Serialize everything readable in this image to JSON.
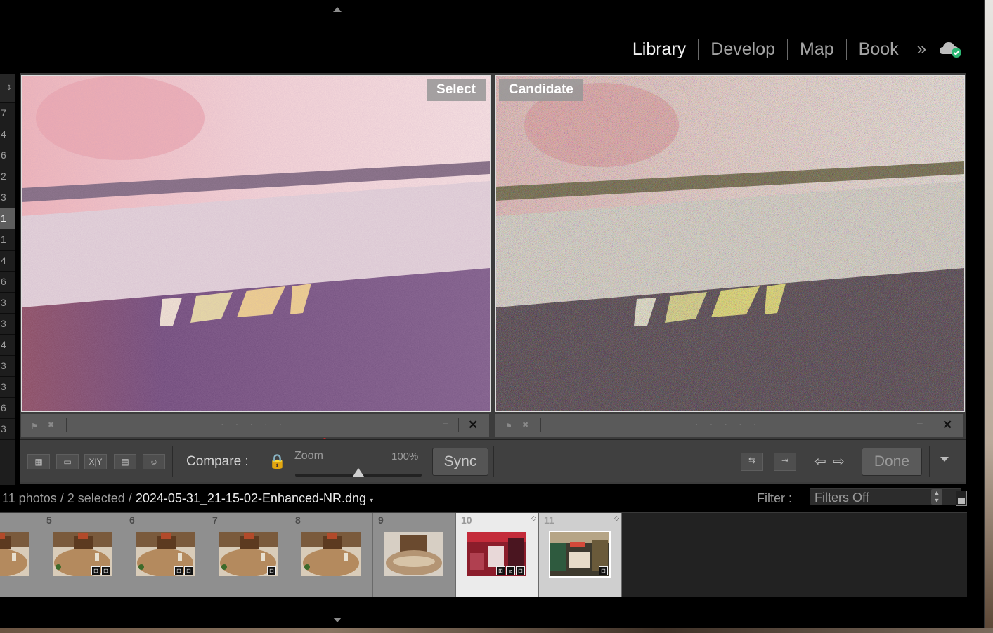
{
  "modules": [
    "Library",
    "Develop",
    "Map",
    "Book"
  ],
  "module_more": "»",
  "left_strip": {
    "top_glyph": "⇕",
    "counts": [
      "7",
      "4",
      "6",
      "2",
      "3",
      "1",
      "1",
      "4",
      "6",
      "3",
      "3",
      "4",
      "3",
      "3",
      "6",
      "3"
    ],
    "selected_index": 5
  },
  "compare": {
    "select_label": "Select",
    "candidate_label": "Candidate",
    "close_glyph": "✕"
  },
  "toolbar": {
    "compare_label": "Compare :",
    "zoom_label": "Zoom",
    "zoom_value": "100%",
    "zoom_level": 0.5,
    "sync_label": "Sync",
    "done_label": "Done",
    "icons": [
      "grid-view-icon",
      "loupe-view-icon",
      "compare-view-icon",
      "survey-view-icon",
      "people-view-icon",
      "lock-icon",
      "swap-icon",
      "make-select-icon",
      "prev-arrow-icon",
      "next-arrow-icon",
      "chevron-down-icon"
    ],
    "xy_glyph": "X|Y"
  },
  "status": {
    "count": "11 photos",
    "selected": "/ 2 selected /",
    "filename": "2024-05-31_21-15-02-Enhanced-NR.dng",
    "filter_label": "Filter :",
    "filter_value": "Filters Off"
  },
  "filmstrip": [
    {
      "num": "",
      "type": "table",
      "badges": []
    },
    {
      "num": "5",
      "type": "table",
      "badges": [
        "⊞",
        "⊡"
      ]
    },
    {
      "num": "6",
      "type": "table",
      "badges": [
        "⊞",
        "⊡"
      ]
    },
    {
      "num": "7",
      "type": "table",
      "badges": [
        "⊡"
      ]
    },
    {
      "num": "8",
      "type": "table",
      "badges": []
    },
    {
      "num": "9",
      "type": "table2",
      "badges": []
    },
    {
      "num": "10",
      "type": "red",
      "badges": [
        "⊞",
        "⧄",
        "⊡"
      ],
      "selected": true
    },
    {
      "num": "11",
      "type": "green",
      "badges": [
        "⊡"
      ],
      "selected": true,
      "secondary": true
    }
  ],
  "colors": {
    "accent": "#e4e4e4",
    "cloud_check": "#2bb673"
  }
}
